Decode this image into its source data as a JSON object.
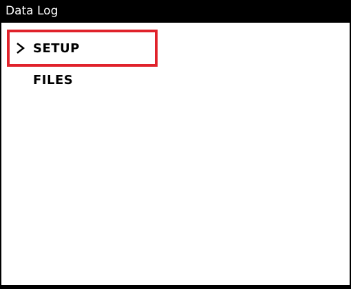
{
  "window": {
    "title": "Data Log"
  },
  "menu": {
    "items": [
      {
        "label": "SETUP",
        "selected": true,
        "indicator_icon": "chevron-right-icon"
      },
      {
        "label": "FILES",
        "selected": false
      }
    ]
  },
  "colors": {
    "title_bar_bg": "#000000",
    "title_text": "#ffffff",
    "selection_border": "#e0222b",
    "background": "#ffffff"
  }
}
